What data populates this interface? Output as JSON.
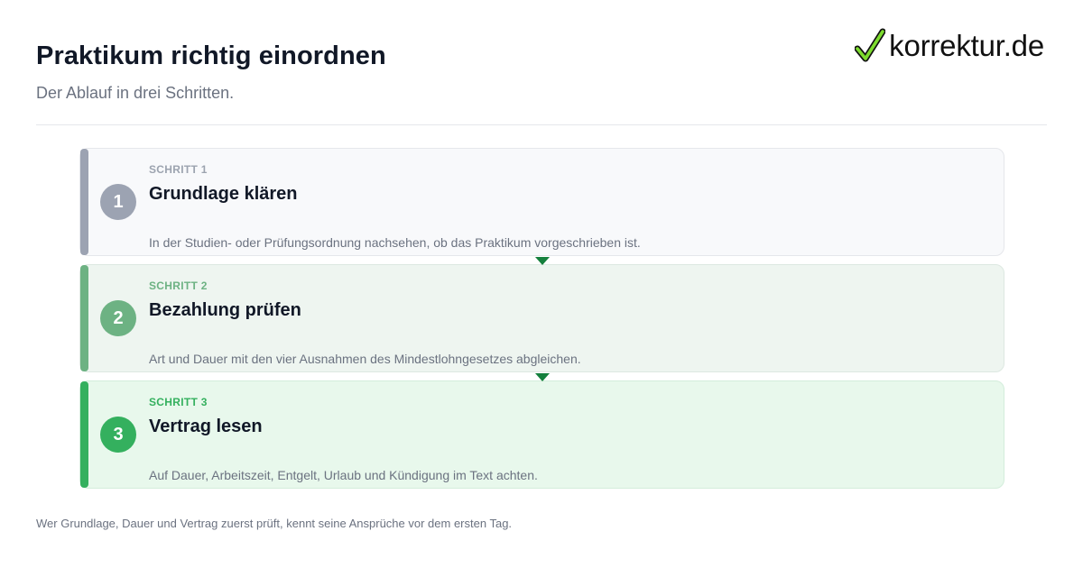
{
  "header": {
    "title": "Praktikum richtig einordnen",
    "subtitle": "Der Ablauf in drei Schritten."
  },
  "brand": {
    "name": "korrektur.de",
    "icon": "checkmark-icon",
    "accent": "#7ddc2e"
  },
  "steps": [
    {
      "kicker": "SCHRITT 1",
      "number": "1",
      "title": "Grundlage klären",
      "description": "In der Studien- oder Prüfungsordnung nachsehen, ob das Praktikum vorgeschrieben ist.",
      "color": "#9ca3b2"
    },
    {
      "kicker": "SCHRITT 2",
      "number": "2",
      "title": "Bezahlung prüfen",
      "description": "Art und Dauer mit den vier Ausnahmen des Mindestlohngesetzes abgleichen.",
      "color": "#6db283"
    },
    {
      "kicker": "SCHRITT 3",
      "number": "3",
      "title": "Vertrag lesen",
      "description": "Auf Dauer, Arbeitszeit, Entgelt, Urlaub und Kündigung im Text achten.",
      "color": "#34b05e"
    }
  ],
  "footer": {
    "note": "Wer Grundlage, Dauer und Vertrag zuerst prüft, kennt seine Ansprüche vor dem ersten Tag."
  }
}
